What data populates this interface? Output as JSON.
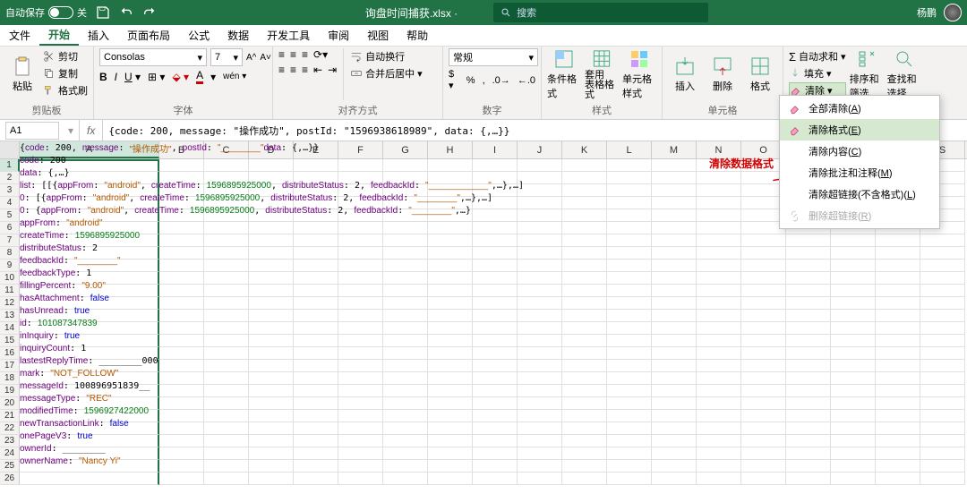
{
  "title": {
    "autosave": "自动保存",
    "autosave_state": "关",
    "filename": "询盘时间捕获.xlsx ·",
    "search_placeholder": "搜索",
    "user": "杨鹏"
  },
  "menu": {
    "tabs": [
      "文件",
      "开始",
      "插入",
      "页面布局",
      "公式",
      "数据",
      "开发工具",
      "审阅",
      "视图",
      "帮助"
    ],
    "active": 1
  },
  "ribbon": {
    "clipboard": {
      "paste": "粘贴",
      "cut": "剪切",
      "copy": "复制",
      "brush": "格式刷",
      "label": "剪贴板"
    },
    "font": {
      "name": "Consolas",
      "size": "7",
      "label": "字体"
    },
    "align": {
      "wrap": "自动换行",
      "merge": "合并后居中",
      "label": "对齐方式"
    },
    "number": {
      "format": "常规",
      "label": "数字"
    },
    "styles": {
      "cond": "条件格式",
      "table": "套用\n表格格式",
      "cell": "单元格样式",
      "label": "样式"
    },
    "cells": {
      "insert": "插入",
      "delete": "删除",
      "format": "格式",
      "label": "单元格"
    },
    "editing": {
      "sum": "自动求和",
      "fill": "填充",
      "clear": "清除",
      "sort": "排序和筛选",
      "find": "查找和选择"
    }
  },
  "namebox": "A1",
  "formula": "{code: 200, message: \"操作成功\", postId: \"1596938618989\", data: {,…}}",
  "columns": [
    "A",
    "B",
    "C",
    "D",
    "E",
    "F",
    "G",
    "H",
    "I",
    "J",
    "K",
    "L",
    "M",
    "N",
    "O",
    "P",
    "Q",
    "R",
    "S"
  ],
  "annotation": "清除数据格式",
  "dropdown": {
    "items": [
      {
        "label": "全部清除(A)",
        "icon": "eraser"
      },
      {
        "label": "清除格式(E)",
        "icon": "eraser-format",
        "hl": true
      },
      {
        "label": "清除内容(C)"
      },
      {
        "label": "清除批注和注释(M)"
      },
      {
        "label": "清除超链接(不含格式)(L)"
      },
      {
        "label": "删除超链接(R)",
        "icon": "unlink",
        "disabled": true
      }
    ]
  },
  "rows": [
    "{code: 200, message: \"操作成功\", postId: \"________\" data: {,…}}",
    "  code: 200",
    "  data: {,…}",
    "    list: [[{appFrom: \"android\", createTime: 1596895925000, distributeStatus: 2, feedbackId: \"____________\",…},…]",
    "      0: [{appFrom: \"android\", createTime: 1596895925000, distributeStatus: 2, feedbackId: \"________\",…},…]",
    "        0: {appFrom: \"android\", createTime: 1596895925000, distributeStatus: 2, feedbackId: \"________\",…}",
    "          appFrom: \"android\"",
    "          createTime: 1596895925000",
    "          distributeStatus: 2",
    "          feedbackId: \"________\"",
    "          feedbackType: 1",
    "          fillingPercent: \"9.00\"",
    "          hasAttachment: false",
    "          hasUnread: true",
    "          id: 101087347839",
    "          inInquiry: true",
    "          inquiryCount: 1",
    "          lastestReplyTime: ________000",
    "          mark: \"NOT_FOLLOW\"",
    "          messageId: 100896951839__",
    "          messageType: \"REC\"",
    "          modifiedTime: 1596927422000",
    "          newTransactionLink: false",
    "          onePageV3: true",
    "          ownerId: ________",
    "          ownerName: \"Nancy Yi\""
  ]
}
